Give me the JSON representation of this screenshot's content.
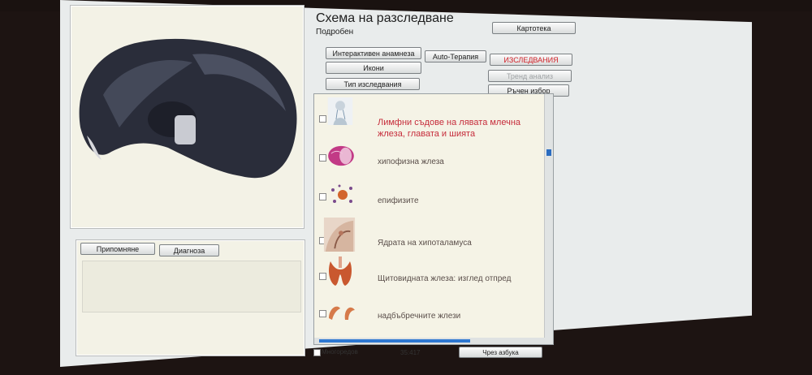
{
  "window": {
    "title": "Схема на разследване",
    "subtitle": "Подробен"
  },
  "toolbar": {
    "kartoteka": "Картотека",
    "interactive_anamnesis": "Интерактивен анамнеза",
    "auto_therapy": "Auto-Терапия",
    "research": "ИЗСЛЕДВАНИЯ",
    "icons": "Икони",
    "trend_analysis": "Тренд анализ",
    "research_type": "Тип изследвания",
    "manual_select": "Ръчен избор"
  },
  "notes_panel": {
    "remind_tab": "Припомняне",
    "diagnosis_tab": "Диагноза"
  },
  "list": {
    "items": [
      {
        "label": "Лимфни съдове на лявата млечна жлеза, главата и шията",
        "icon": "head-lymph-thumbnail"
      },
      {
        "label": "хипофизна жлеза",
        "icon": "pituitary-thumbnail"
      },
      {
        "label": "епифизите",
        "icon": "epiphysis-thumbnail"
      },
      {
        "label": "Ядрата на хипоталамуса",
        "icon": "hypothalamus-thumbnail"
      },
      {
        "label": "Щитовидната жлеза: изглед отпред",
        "icon": "thyroid-thumbnail"
      },
      {
        "label": "надбъбречните жлези",
        "icon": "adrenal-thumbnail"
      }
    ]
  },
  "status_bar": {
    "multiple_label": "Многоредов",
    "counter": "35:417",
    "alphabet_button": "Чрез азбука"
  },
  "colors": {
    "accent_red": "#d2232a",
    "scroll_blue": "#2e78d2",
    "panel_bg": "#f3f2e6"
  }
}
